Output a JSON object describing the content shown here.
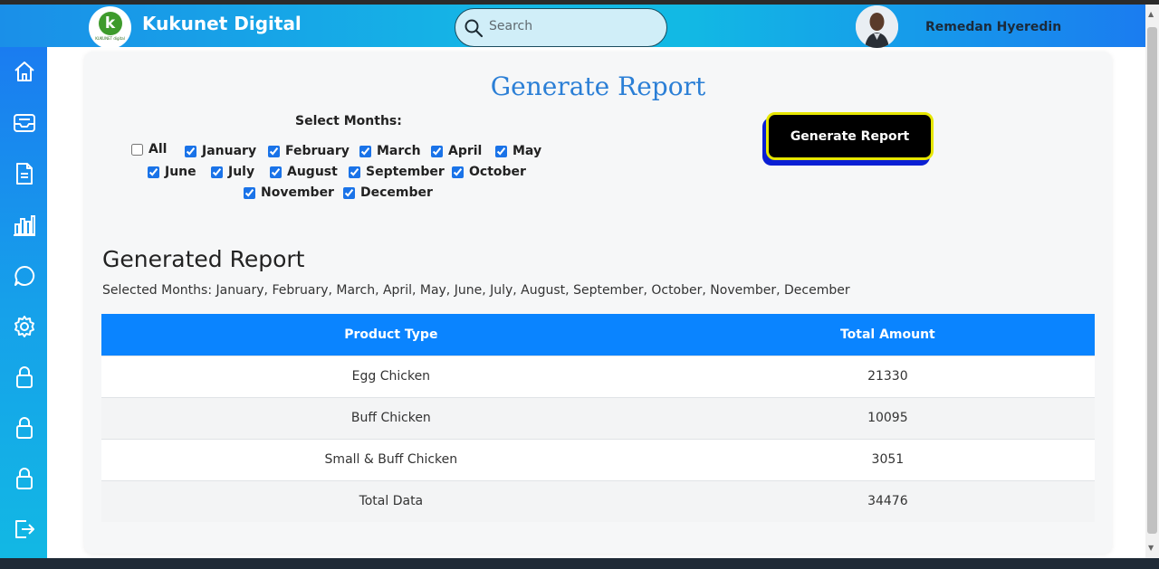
{
  "header": {
    "brand": "Kukunet Digital",
    "logo_text": "KUKUNET digital",
    "search_placeholder": "Search",
    "user_name": "Remedan Hyeredin"
  },
  "sidebar": {
    "items": [
      {
        "icon": "home-icon"
      },
      {
        "icon": "inbox-icon"
      },
      {
        "icon": "document-icon"
      },
      {
        "icon": "chart-icon"
      },
      {
        "icon": "chat-icon"
      },
      {
        "icon": "gear-icon"
      },
      {
        "icon": "lock-icon"
      },
      {
        "icon": "lock-icon"
      },
      {
        "icon": "lock-icon"
      },
      {
        "icon": "logout-icon"
      }
    ]
  },
  "report_form": {
    "title": "Generate Report",
    "select_label": "Select Months:",
    "months": [
      {
        "label": "All",
        "checked": false
      },
      {
        "label": "January",
        "checked": true
      },
      {
        "label": "February",
        "checked": true
      },
      {
        "label": "March",
        "checked": true
      },
      {
        "label": "April",
        "checked": true
      },
      {
        "label": "May",
        "checked": true
      },
      {
        "label": "June",
        "checked": true
      },
      {
        "label": "July",
        "checked": true
      },
      {
        "label": "August",
        "checked": true
      },
      {
        "label": "September",
        "checked": true
      },
      {
        "label": "October",
        "checked": true
      },
      {
        "label": "November",
        "checked": true
      },
      {
        "label": "December",
        "checked": true
      }
    ],
    "button_label": "Generate Report"
  },
  "report": {
    "heading": "Generated Report",
    "selected_months": "Selected Months: January, February, March, April, May, June, July, August, September, October, November, December",
    "columns": [
      "Product Type",
      "Total Amount"
    ],
    "rows": [
      {
        "product": "Egg Chicken",
        "amount": "21330"
      },
      {
        "product": "Buff Chicken",
        "amount": "10095"
      },
      {
        "product": "Small & Buff Chicken",
        "amount": "3051"
      },
      {
        "product": "Total Data",
        "amount": "34476"
      }
    ]
  },
  "colors": {
    "accent": "#0a84ff",
    "title": "#2b7fd6",
    "button_bg": "#000000",
    "button_border": "#e6e600"
  }
}
